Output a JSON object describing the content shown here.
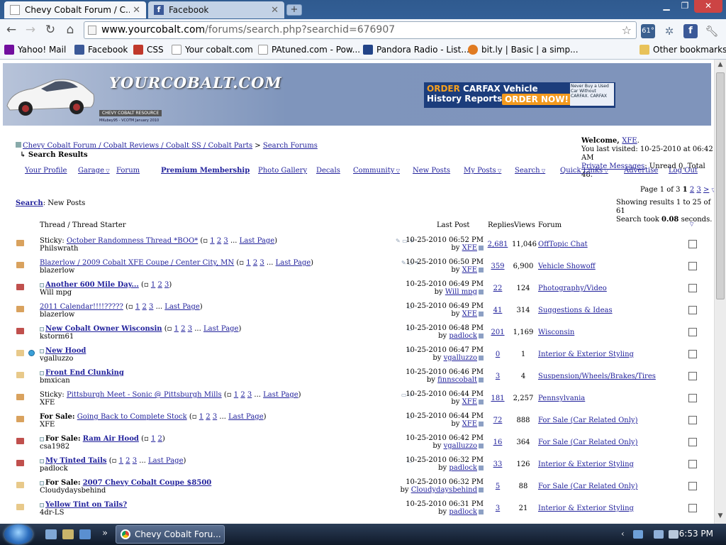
{
  "browser": {
    "tabs": [
      {
        "label": "Chevy Cobalt Forum / C...",
        "active": true
      },
      {
        "label": "Facebook",
        "active": false
      }
    ],
    "new_tab_label": "+",
    "url_host": "www.yourcobalt.com",
    "url_path": "/forums/search.php?searchid=676907",
    "weather_badge": "61°",
    "bookmarks": [
      {
        "label": "Yahoo! Mail",
        "icon": "yahoo-icon",
        "color": "#720e9e"
      },
      {
        "label": "Facebook",
        "icon": "facebook-icon",
        "color": "#3b5998"
      },
      {
        "label": "CSS",
        "icon": "css-icon",
        "color": "#c0392b"
      },
      {
        "label": "Your cobalt.com",
        "icon": "page-icon",
        "color": "#dddddd"
      },
      {
        "label": "PAtuned.com - Pow...",
        "icon": "page-icon",
        "color": "#dddddd"
      },
      {
        "label": "Pandora Radio - List...",
        "icon": "pandora-icon",
        "color": "#224488"
      },
      {
        "label": "bit.ly | Basic | a simp...",
        "icon": "bitly-icon",
        "color": "#e07b22"
      }
    ],
    "other_bookmarks": "Other bookmarks"
  },
  "site": {
    "logo_text": "YOURCOBALT.COM",
    "logo_sub": "CHEVY COBALT RESOURCE",
    "logo_credit": "MKubey95 - VCOTM January 2010",
    "ad": {
      "line1_orange": "ORDER",
      "line1_rest": " CARFAX Vehicle",
      "line2": "History Reports",
      "button": "ORDER NOW!",
      "side": "Never Buy a Used Car Without CARFAX. CARFAX"
    }
  },
  "breadcrumb": {
    "path": "Chevy Cobalt Forum / Cobalt Reviews / Cobalt SS / Cobalt Parts",
    "separator": " > ",
    "current": "Search Forums",
    "page_title": "Search Results"
  },
  "welcome": {
    "prefix": "Welcome, ",
    "user": "XFE",
    "suffix": ".",
    "last_visited": "You last visited: 10-25-2010 at 06:42 AM",
    "pm_label": "Private Messages",
    "pm_detail": ": Unread 0, Total 48."
  },
  "nav": [
    {
      "label": "Your Profile",
      "dropdown": false
    },
    {
      "label": "Garage",
      "dropdown": true
    },
    {
      "label": "Forum",
      "dropdown": false
    },
    {
      "label": "Premium Membership",
      "dropdown": false
    },
    {
      "label": "Photo Gallery",
      "dropdown": false
    },
    {
      "label": "Decals",
      "dropdown": false
    },
    {
      "label": "Community",
      "dropdown": true
    },
    {
      "label": "New Posts",
      "dropdown": false
    },
    {
      "label": "My Posts",
      "dropdown": true
    },
    {
      "label": "Search",
      "dropdown": true
    },
    {
      "label": "Quick Links",
      "dropdown": true
    },
    {
      "label": "Advertise",
      "dropdown": false
    },
    {
      "label": "Log Out",
      "dropdown": false
    }
  ],
  "pagination": {
    "label": "Page 1 of 3",
    "current": "1",
    "pages": [
      "2",
      "3"
    ],
    "next": ">"
  },
  "search_summary": {
    "search_label": "Search",
    "search_value": ": New Posts",
    "showing": "Showing results 1 to 25 of 61",
    "took_prefix": "Search took ",
    "took_value": "0.08",
    "took_suffix": " seconds."
  },
  "columns": {
    "thread": "Thread / Thread Starter",
    "last_post": "Last Post",
    "replies": "Replies",
    "views": "Views",
    "forum": "Forum"
  },
  "threads": [
    {
      "prefix": "Sticky:",
      "title": "October Randomness Thread *BOO*",
      "bold": false,
      "poll": false,
      "pages": [
        "1",
        "2",
        "3"
      ],
      "last": "Last Page",
      "starter": "Philswrath",
      "date": "10-25-2010 06:52 PM",
      "by": "XFE",
      "replies": "2,681",
      "views": "11,046",
      "forum": "OffTopic Chat",
      "attach": "✎ ▭ ✈",
      "icon_color": "#d9a25e",
      "question": false
    },
    {
      "prefix": "",
      "title": "Blazerlow / 2009 Cobalt XFE Coupe / Center City, MN",
      "bold": false,
      "poll": false,
      "pages": [
        "1",
        "2",
        "3"
      ],
      "last": "Last Page",
      "starter": "blazerlow",
      "date": "10-25-2010 06:50 PM",
      "by": "XFE",
      "replies": "359",
      "views": "6,900",
      "forum": "Vehicle Showoff",
      "attach": "✎ ▭ ✈",
      "icon_color": "#d9a25e",
      "question": false
    },
    {
      "prefix": "",
      "title": "Another 600 Mile Day...",
      "bold": true,
      "poll": true,
      "pages": [
        "1",
        "2",
        "3"
      ],
      "last": "",
      "starter": "Will mpg",
      "date": "10-25-2010 06:49 PM",
      "by": "Will mpg",
      "replies": "22",
      "views": "124",
      "forum": "Photography/Video",
      "attach": "",
      "icon_color": "#c0504d",
      "question": false
    },
    {
      "prefix": "",
      "title": "2011 Calendar!!!!?????",
      "bold": false,
      "poll": false,
      "pages": [
        "1",
        "2",
        "3"
      ],
      "last": "Last Page",
      "starter": "blazerlow",
      "date": "10-25-2010 06:49 PM",
      "by": "XFE",
      "replies": "41",
      "views": "314",
      "forum": "Suggestions & Ideas",
      "attach": "▭",
      "icon_color": "#d9a25e",
      "question": false
    },
    {
      "prefix": "",
      "title": "New Cobalt Owner Wisconsin",
      "bold": true,
      "poll": true,
      "pages": [
        "1",
        "2",
        "3"
      ],
      "last": "Last Page",
      "starter": "kstorm61",
      "date": "10-25-2010 06:48 PM",
      "by": "padlock",
      "replies": "201",
      "views": "1,169",
      "forum": "Wisconsin",
      "attach": "▭",
      "icon_color": "#c0504d",
      "question": false
    },
    {
      "prefix": "",
      "title": "New Hood",
      "bold": true,
      "poll": true,
      "pages": [],
      "last": "",
      "starter": "vgalluzzo",
      "date": "10-25-2010 06:47 PM",
      "by": "vgalluzzo",
      "replies": "0",
      "views": "1",
      "forum": "Interior & Exterior Styling",
      "attach": "✎",
      "icon_color": "#e8c98a",
      "question": true
    },
    {
      "prefix": "",
      "title": "Front End Clunking",
      "bold": true,
      "poll": true,
      "pages": [],
      "last": "",
      "starter": "bmxican",
      "date": "10-25-2010 06:46 PM",
      "by": "finnscobalt",
      "replies": "3",
      "views": "4",
      "forum": "Suspension/Wheels/Brakes/Tires",
      "attach": "",
      "icon_color": "#e8c98a",
      "question": false
    },
    {
      "prefix": "Sticky:",
      "title": "Pittsburgh Meet - Sonic @ Pittsburgh Mills",
      "bold": false,
      "poll": false,
      "pages": [
        "1",
        "2",
        "3"
      ],
      "last": "Last Page",
      "starter": "XFE",
      "date": "10-25-2010 06:44 PM",
      "by": "XFE",
      "replies": "181",
      "views": "2,257",
      "forum": "Pennsylvania",
      "attach": "▭ ✈",
      "icon_color": "#d9a25e",
      "question": false
    },
    {
      "prefix": "For Sale:",
      "title": "Going Back to Complete Stock",
      "bold": false,
      "poll": false,
      "pages": [
        "1",
        "2",
        "3"
      ],
      "last": "Last Page",
      "starter": "XFE",
      "date": "10-25-2010 06:44 PM",
      "by": "XFE",
      "replies": "72",
      "views": "888",
      "forum": "For Sale (Car Related Only)",
      "attach": "▭",
      "icon_color": "#d9a25e",
      "question": false
    },
    {
      "prefix": "For Sale:",
      "title": "Ram Air Hood",
      "bold": true,
      "poll": true,
      "pages": [
        "1",
        "2"
      ],
      "last": "",
      "starter": "csa1982",
      "date": "10-25-2010 06:42 PM",
      "by": "vgalluzzo",
      "replies": "16",
      "views": "364",
      "forum": "For Sale (Car Related Only)",
      "attach": "",
      "icon_color": "#c0504d",
      "question": false
    },
    {
      "prefix": "",
      "title": "My Tinted Tails",
      "bold": true,
      "poll": true,
      "pages": [
        "1",
        "2",
        "3"
      ],
      "last": "Last Page",
      "starter": "padlock",
      "date": "10-25-2010 06:32 PM",
      "by": "padlock",
      "replies": "33",
      "views": "126",
      "forum": "Interior & Exterior Styling",
      "attach": "▭",
      "icon_color": "#c0504d",
      "question": false
    },
    {
      "prefix": "For Sale:",
      "title": "2007 Chevy Cobalt Coupe $8500",
      "bold": true,
      "poll": true,
      "pages": [],
      "last": "",
      "starter": "Cloudydaysbehind",
      "date": "10-25-2010 06:32 PM",
      "by": "Cloudydaysbehind",
      "replies": "5",
      "views": "88",
      "forum": "For Sale (Car Related Only)",
      "attach": "",
      "icon_color": "#e8c98a",
      "question": false
    },
    {
      "prefix": "",
      "title": "Yellow Tint on Tails?",
      "bold": true,
      "poll": true,
      "pages": [],
      "last": "",
      "starter": "4dr-LS",
      "date": "10-25-2010 06:31 PM",
      "by": "padlock",
      "replies": "3",
      "views": "21",
      "forum": "Interior & Exterior Styling",
      "attach": "",
      "icon_color": "#e8c98a",
      "question": false
    }
  ],
  "taskbar": {
    "task_label": "Chevy Cobalt Foru...",
    "clock": "6:53 PM",
    "show_more": "»"
  }
}
